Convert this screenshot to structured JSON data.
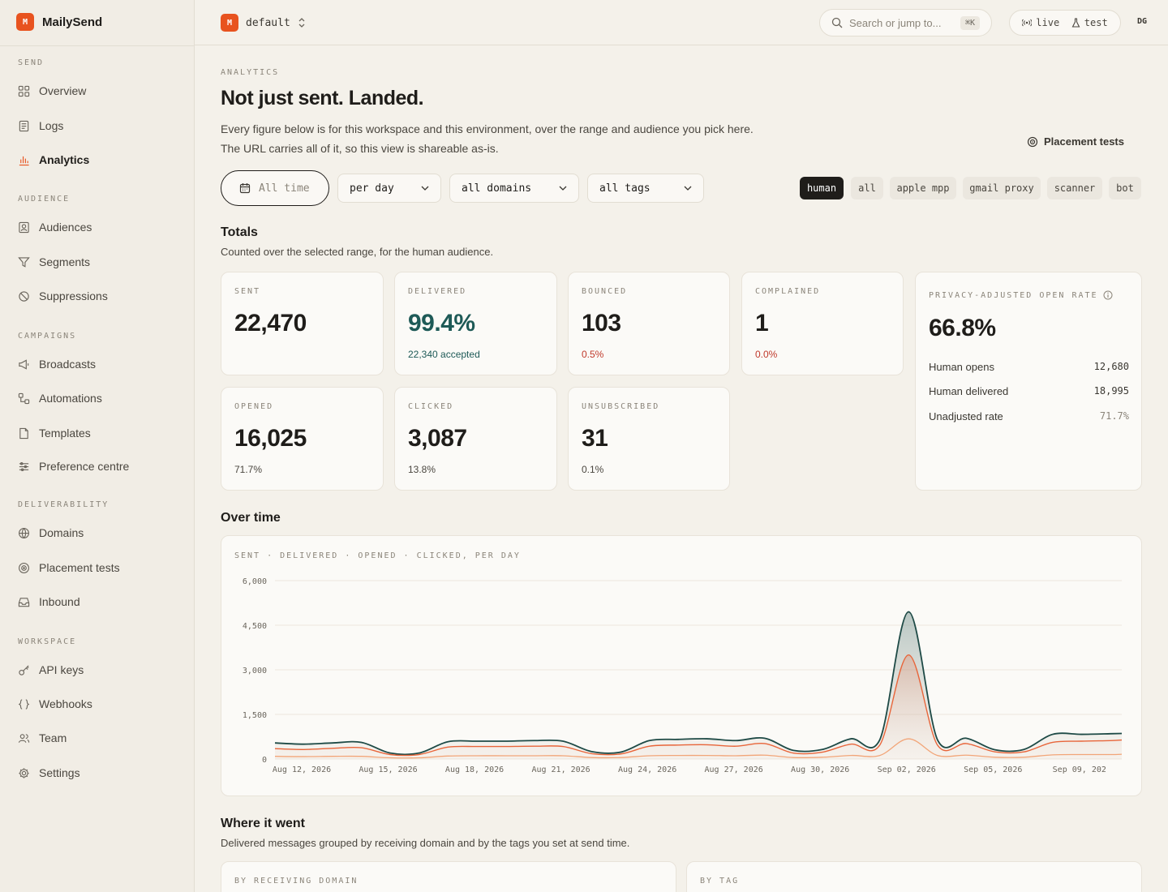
{
  "brand": {
    "logo": "M",
    "name": "MailySend"
  },
  "sidebar": {
    "sections": [
      {
        "label": "SEND",
        "items": [
          {
            "label": "Overview",
            "icon": "grid-icon"
          },
          {
            "label": "Logs",
            "icon": "logs-icon"
          },
          {
            "label": "Analytics",
            "icon": "bar-chart-icon",
            "active": true
          }
        ]
      },
      {
        "label": "AUDIENCE",
        "items": [
          {
            "label": "Audiences",
            "icon": "contact-icon"
          },
          {
            "label": "Segments",
            "icon": "filter-icon"
          },
          {
            "label": "Suppressions",
            "icon": "ban-icon"
          }
        ]
      },
      {
        "label": "CAMPAIGNS",
        "items": [
          {
            "label": "Broadcasts",
            "icon": "megaphone-icon"
          },
          {
            "label": "Automations",
            "icon": "workflow-icon"
          },
          {
            "label": "Templates",
            "icon": "file-icon"
          },
          {
            "label": "Preference centre",
            "icon": "sliders-icon"
          }
        ]
      },
      {
        "label": "DELIVERABILITY",
        "items": [
          {
            "label": "Domains",
            "icon": "globe-icon"
          },
          {
            "label": "Placement tests",
            "icon": "target-icon"
          },
          {
            "label": "Inbound",
            "icon": "inbox-icon"
          }
        ]
      },
      {
        "label": "WORKSPACE",
        "items": [
          {
            "label": "API keys",
            "icon": "key-icon"
          },
          {
            "label": "Webhooks",
            "icon": "braces-icon"
          },
          {
            "label": "Team",
            "icon": "users-icon"
          },
          {
            "label": "Settings",
            "icon": "gear-icon"
          }
        ]
      }
    ]
  },
  "topbar": {
    "env_logo": "M",
    "env_name": "default",
    "search_placeholder": "Search or jump to...",
    "search_shortcut": "⌘K",
    "mode_live": "live",
    "mode_test": "test",
    "user_initials": "DG"
  },
  "page": {
    "eyebrow": "ANALYTICS",
    "title": "Not just sent. Landed.",
    "description": "Every figure below is for this workspace and this environment, over the range and audience you pick here. The URL carries all of it, so this view is shareable as-is.",
    "placement_link": "Placement tests"
  },
  "filters": {
    "time": "All time",
    "granularity": "per day",
    "domains": "all domains",
    "tags": "all tags",
    "audience_chips": [
      "human",
      "all",
      "apple mpp",
      "gmail proxy",
      "scanner",
      "bot"
    ],
    "audience_selected": "human"
  },
  "totals": {
    "title": "Totals",
    "subtitle": "Counted over the selected range, for the human audience.",
    "sent": {
      "label": "SENT",
      "value": "22,470"
    },
    "delivered": {
      "label": "DELIVERED",
      "value": "99.4%",
      "sub": "22,340 accepted"
    },
    "bounced": {
      "label": "BOUNCED",
      "value": "103",
      "sub": "0.5%"
    },
    "complained": {
      "label": "COMPLAINED",
      "value": "1",
      "sub": "0.0%"
    },
    "opened": {
      "label": "OPENED",
      "value": "16,025",
      "sub": "71.7%"
    },
    "clicked": {
      "label": "CLICKED",
      "value": "3,087",
      "sub": "13.8%"
    },
    "unsubscribed": {
      "label": "UNSUBSCRIBED",
      "value": "31",
      "sub": "0.1%"
    },
    "privacy": {
      "label": "PRIVACY-ADJUSTED OPEN RATE",
      "value": "66.8%",
      "rows": [
        {
          "label": "Human opens",
          "value": "12,680"
        },
        {
          "label": "Human delivered",
          "value": "18,995"
        },
        {
          "label": "Unadjusted rate",
          "value": "71.7%"
        }
      ]
    }
  },
  "over_time": {
    "title": "Over time"
  },
  "chart_data": {
    "type": "area",
    "title": "SENT · DELIVERED · OPENED · CLICKED, PER DAY",
    "ylim": [
      0,
      6000
    ],
    "yticks": [
      "6,000",
      "4,500",
      "3,000",
      "1,500",
      "0"
    ],
    "ytick_values": [
      6000,
      4500,
      3000,
      1500,
      0
    ],
    "xticks": [
      "Aug 12, 2026",
      "Aug 15, 2026",
      "Aug 18, 2026",
      "Aug 21, 2026",
      "Aug 24, 2026",
      "Aug 27, 2026",
      "Aug 30, 2026",
      "Sep 02, 2026",
      "Sep 05, 2026",
      "Sep 09, 202"
    ],
    "xtick_days": [
      0,
      3,
      6,
      9,
      12,
      15,
      18,
      21,
      24,
      27
    ],
    "x_start": "Aug 12, 2026",
    "x_end_day": 29.4,
    "grid": true,
    "colors": {
      "sent": "#1e4a46",
      "delivered": "#a8bcb8",
      "opened": "#e8653a",
      "clicked": "#f2a578",
      "grid": "#ece7dd",
      "axis_text": "#6a655c"
    },
    "series": [
      {
        "name": "SENT",
        "x": [
          0,
          1,
          2,
          3,
          4,
          5,
          6,
          7,
          8,
          9,
          10,
          11,
          12,
          13,
          14,
          15,
          16,
          17,
          18,
          19,
          20,
          21,
          22,
          23,
          24,
          25,
          26,
          27,
          28,
          29,
          29.4
        ],
        "values": [
          540,
          500,
          540,
          560,
          200,
          200,
          580,
          600,
          600,
          620,
          600,
          250,
          230,
          620,
          660,
          680,
          620,
          700,
          290,
          320,
          680,
          650,
          4950,
          650,
          700,
          310,
          320,
          830,
          830,
          850,
          860
        ]
      },
      {
        "name": "OPENED",
        "x": [
          0,
          1,
          2,
          3,
          4,
          5,
          6,
          7,
          8,
          9,
          10,
          11,
          12,
          13,
          14,
          15,
          16,
          17,
          18,
          19,
          20,
          21,
          22,
          23,
          24,
          25,
          26,
          27,
          28,
          29,
          29.4
        ],
        "values": [
          350,
          320,
          360,
          380,
          150,
          150,
          400,
          420,
          420,
          430,
          420,
          180,
          170,
          430,
          470,
          480,
          430,
          520,
          200,
          230,
          500,
          470,
          3500,
          470,
          520,
          240,
          240,
          560,
          600,
          620,
          640
        ]
      },
      {
        "name": "CLICKED",
        "x": [
          0,
          1,
          2,
          3,
          4,
          5,
          6,
          7,
          8,
          9,
          10,
          11,
          12,
          13,
          14,
          15,
          16,
          17,
          18,
          19,
          20,
          21,
          22,
          23,
          24,
          25,
          26,
          27,
          28,
          29,
          29.4
        ],
        "values": [
          90,
          80,
          90,
          90,
          40,
          40,
          100,
          110,
          110,
          110,
          110,
          50,
          50,
          110,
          120,
          120,
          110,
          130,
          50,
          60,
          120,
          120,
          680,
          120,
          130,
          60,
          60,
          140,
          150,
          150,
          160
        ]
      }
    ]
  },
  "where": {
    "title": "Where it went",
    "subtitle": "Delivered messages grouped by receiving domain and by the tags you set at send time.",
    "by_domain_label": "BY RECEIVING DOMAIN",
    "by_tag_label": "BY TAG"
  }
}
